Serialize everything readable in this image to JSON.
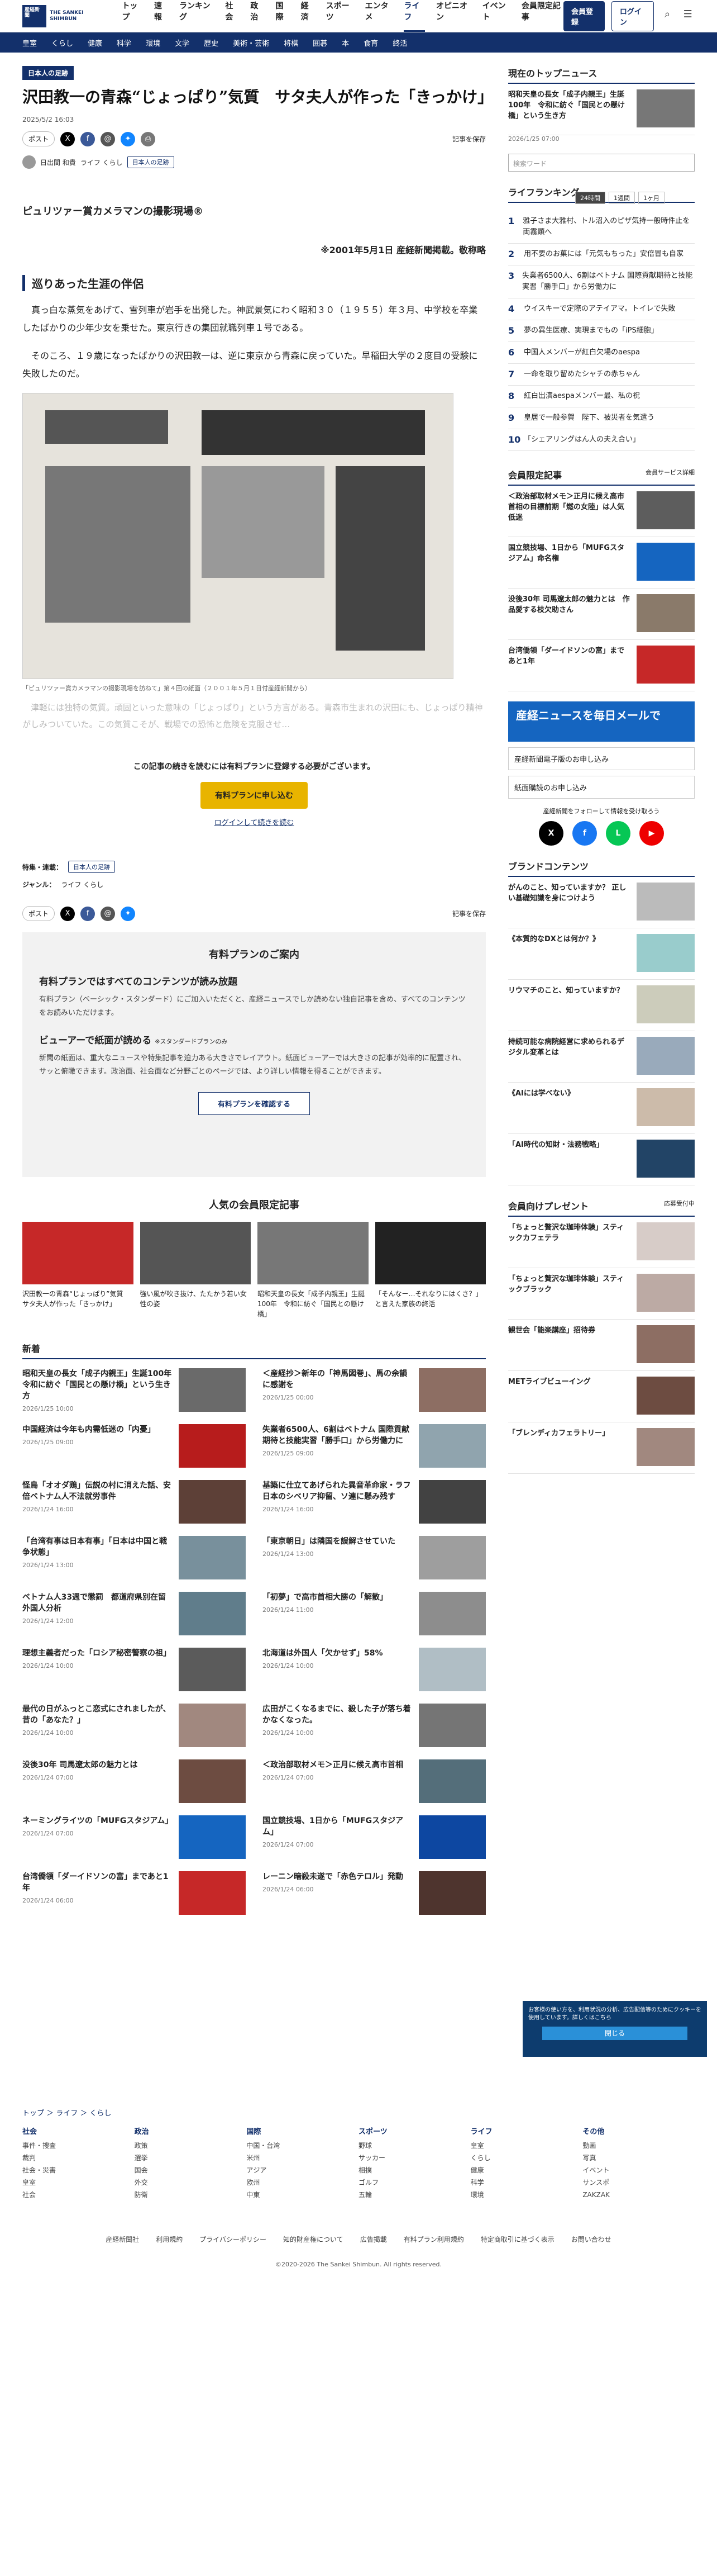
{
  "header": {
    "logo_text": "産経新聞",
    "logo_sub": "THE SANKEI SHIMBUN",
    "nav": [
      "トップ",
      "速報",
      "ランキング",
      "社会",
      "政治",
      "国際",
      "経済",
      "スポーツ",
      "エンタメ",
      "ライフ",
      "オピニオン",
      "イベント",
      "会員限定記事"
    ],
    "member_btn": "会員登録",
    "login_btn": "ログイン",
    "subnav": [
      "皇室",
      "くらし",
      "健康",
      "科学",
      "環境",
      "文学",
      "歴史",
      "美術・芸術",
      "将棋",
      "囲碁",
      "本",
      "食育",
      "終活"
    ]
  },
  "article": {
    "label": "日本人の足跡",
    "title": "沢田教一の青森“じょっぱり”気質　サタ夫人が作った「きっかけ」",
    "datetime": "2025/5/2 16:03",
    "share": "ポスト",
    "save": "記事を保存",
    "author": "日出間 和貴",
    "section": "ライフ くらし",
    "tag": "日本人の足跡",
    "subtitle": "ピュリツァー賞カメラマンの撮影現場®",
    "date_note": "※2001年5月1日 産経新聞掲載。敬称略",
    "h2": "巡りあった生涯の伴侶",
    "p1": "　真っ白な蒸気をあげて、雪列車が岩手を出発した。神武景気にわく昭和３０（１９５５）年３月、中学校を卒業したばかりの少年少女を乗せた。東京行きの集団就職列車１号である。",
    "p2": "　そのころ、１９歳になったばかりの沢田教一は、逆に東京から青森に戻っていた。早稲田大学の２度目の受験に失敗したのだ。",
    "photo_caption": "「ピュリツァー賞カメラマンの撮影現場を訪ねて」第４回の紙面（２００１年５月１日付産経新聞から）",
    "blur": "　津軽には独特の気質。頑固といった意味の「じょっぱり」という方言がある。青森市生まれの沢田にも、じょっぱり精神がしみついていた。この気質こそが、戦場での恐怖と危険を克服させ…",
    "paywall_text": "この記事の続きを読むには有料プランに登録する必要がございます。",
    "paywall_btn": "有料プランに申し込む",
    "paywall_login": "ログインして続きを読む",
    "tags_label": "特集・連載：",
    "genre_label": "ジャンル："
  },
  "plan": {
    "title": "有料プランのご案内",
    "h1": "有料プランではすべてのコンテンツが読み放題",
    "p1": "有料プラン（ベーシック・スタンダード）にご加入いただくと、産経ニュースでしか読めない独自記事を含め、すべてのコンテンツをお読みいただけます。",
    "h2": "ビューアーで紙面が読める",
    "h2note": "※スタンダードプランのみ",
    "p2": "新聞の紙面は、重大なニュースや特集記事を迫力ある大きさでレイアウト。紙面ビューアーでは大きさの記事が効率的に配置され、サッと俯瞰できます。政治面、社会面など分野ごとのページでは、より詳しい情報を得ることができます。",
    "btn": "有料プランを確認する"
  },
  "popular": {
    "title": "人気の会員限定記事",
    "items": [
      "沢田教一の青森“じょっぱり”気質　サタ夫人が作った「きっかけ」",
      "強い風が吹き抜け、たたかう若い女性の姿",
      "昭和天皇の長女「成子内親王」生誕100年　令和に紡ぐ「国民との懸け橋」",
      "「そんなー…それなりにはくさ？」と言えた家族の終活"
    ]
  },
  "news": {
    "title": "新着",
    "items": [
      {
        "t": "昭和天皇の長女「成子内親王」生誕100年　令和に紡ぐ「国民との懸け橋」という生き方",
        "m": "2026/1/25 10:00"
      },
      {
        "t": "＜産経抄＞新年の「神馬図巻」、馬の余韻に感謝を",
        "m": "2026/1/25 00:00"
      },
      {
        "t": "中国経済は今年も内需低迷の「内憂」",
        "m": "2026/1/25 09:00"
      },
      {
        "t": "失業者6500人、6割はベトナム 国際貢献期待と技能実習「勝手口」から労働力に",
        "m": "2026/1/25 09:00"
      },
      {
        "t": "怪鳥「オオダ鶏」伝説の村に消えた話、安倍ベトナム人不法就労事件",
        "m": "2026/1/24 16:00"
      },
      {
        "t": "基築に仕立てあげられた異音革命家・ラフ　日本のシベリア抑留、ソ連に懸み残す",
        "m": "2026/1/24 16:00"
      },
      {
        "t": "「台湾有事は日本有事」「日本は中国と戦争状態」",
        "m": "2026/1/24 13:00"
      },
      {
        "t": "「東京朝日」は隣国を誤解させていた",
        "m": "2026/1/24 13:00"
      },
      {
        "t": "ベトナム人33週で懲罰　都道府県別在留外国人分析",
        "m": "2026/1/24 12:00"
      },
      {
        "t": "「初夢」で高市首相大勝の「解散」",
        "m": "2026/1/24 11:00"
      },
      {
        "t": "理想主義者だった「ロシア秘密警察の祖」",
        "m": "2026/1/24 10:00"
      },
      {
        "t": "北海道は外国人「欠かせず」58%",
        "m": "2026/1/24 10:00"
      },
      {
        "t": "最代の日がふっとこ恋式にされましたが、昔の「あなた？」",
        "m": "2026/1/24 10:00"
      },
      {
        "t": "広田がこくなるまでに、殺した子が落ち着かなくなった。",
        "m": "2026/1/24 10:00"
      },
      {
        "t": "没後30年 司馬遼太郎の魅力とは",
        "m": "2026/1/24 07:00"
      },
      {
        "t": "＜政治部取材メモ＞正月に候え高市首相",
        "m": "2026/1/24 07:00"
      },
      {
        "t": "ネーミングライツの「MUFGスタジアム」",
        "m": "2026/1/24 07:00"
      },
      {
        "t": "国立競技場、1日から「MUFGスタジアム」",
        "m": "2026/1/24 07:00"
      },
      {
        "t": "台湾僑領「ダーイドソンの富」まであと1年",
        "m": "2026/1/24 06:00"
      },
      {
        "t": "レーニン暗殺未遂で「赤色テロル」発動",
        "m": "2026/1/24 06:00"
      }
    ]
  },
  "side": {
    "top_title": "現在のトップニュース",
    "top_item": "昭和天皇の長女「成子内親王」生誕100年　令和に紡ぐ「国民との懸け橋」という生き方",
    "top_date": "2026/1/25 07:00",
    "search_placeholder": "検索ワード",
    "rank_title": "ライフランキング",
    "rank_tabs": [
      "24時間",
      "1週間",
      "1ヶ月"
    ],
    "rank": [
      "雅子さま大雅村、トル沼入のピザ気持一般時件止を両霧顕へ",
      "用不要のお菓には「元気もちった」安倍冒も自家",
      "失業者6500人、6割はベトナム 国際貢献期待と技能実習「勝手口」から労働力に",
      "ウイスキーで定際のアテイアマ。トイレで失敗",
      "夢の異生医療、実現までもの「iPS細胞」",
      "中国人メンバーが紅白欠場のaespa",
      "一命を取り留めたシャチの赤ちゃん",
      "紅白出演aespaメンバー最、私の祝",
      "皇居で一般参賀　陛下、被災者を気遣う",
      "「シェアリングはん人の夫え合い」"
    ],
    "member_title": "会員限定記事",
    "member_link": "会員サービス詳細",
    "member_items": [
      "＜政治部取材メモ＞正月に候え高市首相の目標前期「燃の女陸」は人気低迷",
      "国立競技場、1日から「MUFGスタジアム」命名権",
      "没後30年 司馬遼太郎の魅力とは　作品愛する枝欠助さん",
      "台湾僑領「ダーイドソンの富」まであと1年"
    ],
    "banner1": "産経ニュースを毎日メールで",
    "link1": "産経新聞電子版のお申し込み",
    "link2": "紙面購読のお申し込み",
    "follow": "産経新聞をフォローして情報を受け取ろう",
    "brand_title": "ブランドコンテンツ",
    "brand": [
      "がんのこと、知っていますか？ 正しい基礎知識を身につけよう",
      "《本質的なDXとは何か？》",
      "リウマチのこと、知っていますか？",
      "持続可能な病院経営に求められるデジタル変革とは",
      "《AIには学べない》",
      "「AI時代の知財・法務戦略」"
    ],
    "present_title": "会員向けプレゼント",
    "present_link": "応募受付中",
    "present": [
      "「ちょっと贅沢な珈琲体験」スティックカフェテラ",
      "「ちょっと贅沢な珈琲体験」スティックブラック",
      "観世会「能楽講座」招待券",
      "METライブビューイング",
      "「ブレンディカフェラトリー」"
    ]
  },
  "footer": {
    "crumb": "トップ ＞ ライフ ＞ くらし",
    "cols": [
      {
        "h": "社会",
        "items": [
          "事件・捜査",
          "裁判",
          "社会・災害",
          "皇室",
          "社会"
        ]
      },
      {
        "h": "政治",
        "items": [
          "政策",
          "選挙",
          "国会",
          "外交",
          "防衛"
        ]
      },
      {
        "h": "国際",
        "items": [
          "中国・台湾",
          "米州",
          "アジア",
          "欧州",
          "中東"
        ]
      },
      {
        "h": "スポーツ",
        "items": [
          "野球",
          "サッカー",
          "相撲",
          "ゴルフ",
          "五輪"
        ]
      },
      {
        "h": "ライフ",
        "items": [
          "皇室",
          "くらし",
          "健康",
          "科学",
          "環境"
        ]
      },
      {
        "h": "その他",
        "items": [
          "動画",
          "写真",
          "イベント",
          "サンスポ",
          "ZAKZAK"
        ]
      }
    ],
    "links": [
      "産経新聞社",
      "利用規約",
      "プライバシーポリシー",
      "知的財産権について",
      "広告掲載",
      "有料プラン利用規約",
      "特定商取引に基づく表示",
      "お問い合わせ"
    ],
    "copy": "©2020-2026 The Sankei Shimbun. All rights reserved."
  },
  "cookie": {
    "text": "お客様の使い方を、利用状況の分析、広告配信等のためにクッキーを使用しています。詳しくはこちら",
    "btn": "閉じる"
  }
}
